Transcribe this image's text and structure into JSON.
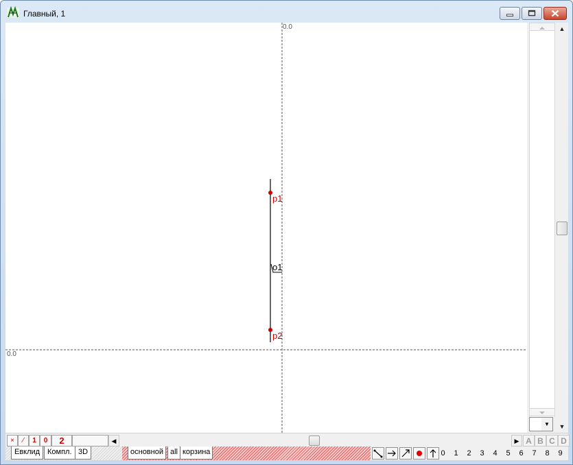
{
  "window": {
    "title": "Главный, 1"
  },
  "canvas": {
    "axis_label_top": "0.0",
    "axis_label_left": "0.0",
    "points": [
      {
        "name": "p1",
        "color": "#cc0000"
      },
      {
        "name": "p2",
        "color": "#cc0000"
      }
    ],
    "object_label": "o1"
  },
  "bottom_toolbar": {
    "mode_buttons": [
      "×",
      "⁄",
      "1",
      "0",
      "2"
    ],
    "letter_buttons": [
      "A",
      "B",
      "C",
      "D"
    ]
  },
  "tabs": [
    "Евклид",
    "Компл.",
    "3D"
  ],
  "layers": [
    "основной",
    "all",
    "корзина"
  ],
  "tool_icons": [
    "segment-icon",
    "arrow-right-icon",
    "diagonal-arrow-icon",
    "point-icon",
    "arrow-up-icon"
  ],
  "numbers": [
    "0",
    "1",
    "2",
    "3",
    "4",
    "5",
    "6",
    "7",
    "8",
    "9"
  ],
  "colors": {
    "accent_red": "#cc0000",
    "layer_bar": "#e06060"
  }
}
